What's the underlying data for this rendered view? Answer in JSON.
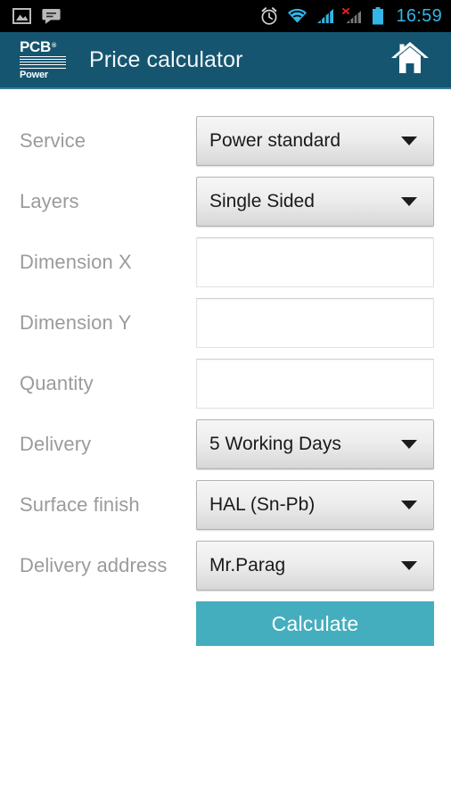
{
  "status_bar": {
    "left_icons": [
      "gallery-image-icon",
      "message-bubble-icon"
    ],
    "right_icons": [
      "alarm-clock-icon",
      "wifi-icon",
      "signal-bars-icon",
      "signal-bars-no-service-icon",
      "battery-icon"
    ],
    "time": "16:59",
    "accent_color": "#33b5e5",
    "background_color": "#000000"
  },
  "header": {
    "logo_primary": "PCB",
    "logo_registered": "®",
    "logo_secondary": "Power",
    "title": "Price calculator",
    "home_icon": "home-icon",
    "background_color": "#15556f",
    "underline_color": "#3f7e96"
  },
  "form": {
    "rows": [
      {
        "label": "Service",
        "type": "dropdown",
        "value": "Power standard"
      },
      {
        "label": "Layers",
        "type": "dropdown",
        "value": "Single Sided"
      },
      {
        "label": "Dimension X",
        "type": "text",
        "value": "",
        "placeholder": ""
      },
      {
        "label": "Dimension Y",
        "type": "text",
        "value": "",
        "placeholder": ""
      },
      {
        "label": "Quantity",
        "type": "text",
        "value": "",
        "placeholder": ""
      },
      {
        "label": "Delivery",
        "type": "dropdown",
        "value": "5 Working Days"
      },
      {
        "label": "Surface finish",
        "type": "dropdown",
        "value": "HAL (Sn-Pb)"
      },
      {
        "label": "Delivery address",
        "type": "dropdown",
        "value": "Mr.Parag"
      }
    ],
    "submit_label": "Calculate",
    "submit_color": "#45aebe",
    "label_color": "#9b9b9b"
  }
}
